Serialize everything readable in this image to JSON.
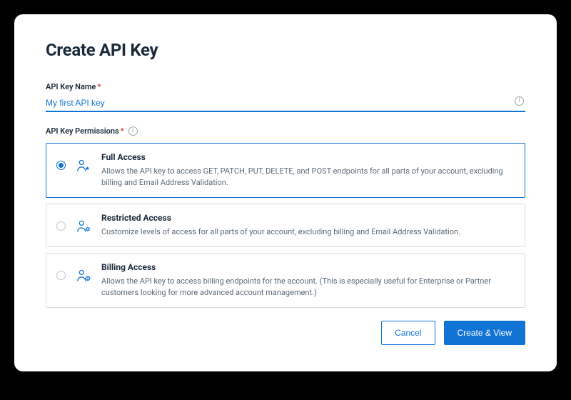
{
  "title": "Create API Key",
  "name_field": {
    "label": "API Key Name",
    "value": "My first API key"
  },
  "permissions": {
    "label": "API Key Permissions",
    "options": [
      {
        "title": "Full Access",
        "desc": "Allows the API key to access GET, PATCH, PUT, DELETE, and POST endpoints for all parts of your account, excluding billing and Email Address Validation.",
        "selected": true
      },
      {
        "title": "Restricted Access",
        "desc": "Customize levels of access for all parts of your account, excluding billing and Email Address Validation.",
        "selected": false
      },
      {
        "title": "Billing Access",
        "desc": "Allows the API key to access billing endpoints for the account. (This is especially useful for Enterprise or Partner customers looking for more advanced account management.)",
        "selected": false
      }
    ]
  },
  "buttons": {
    "cancel": "Cancel",
    "submit": "Create & View"
  }
}
